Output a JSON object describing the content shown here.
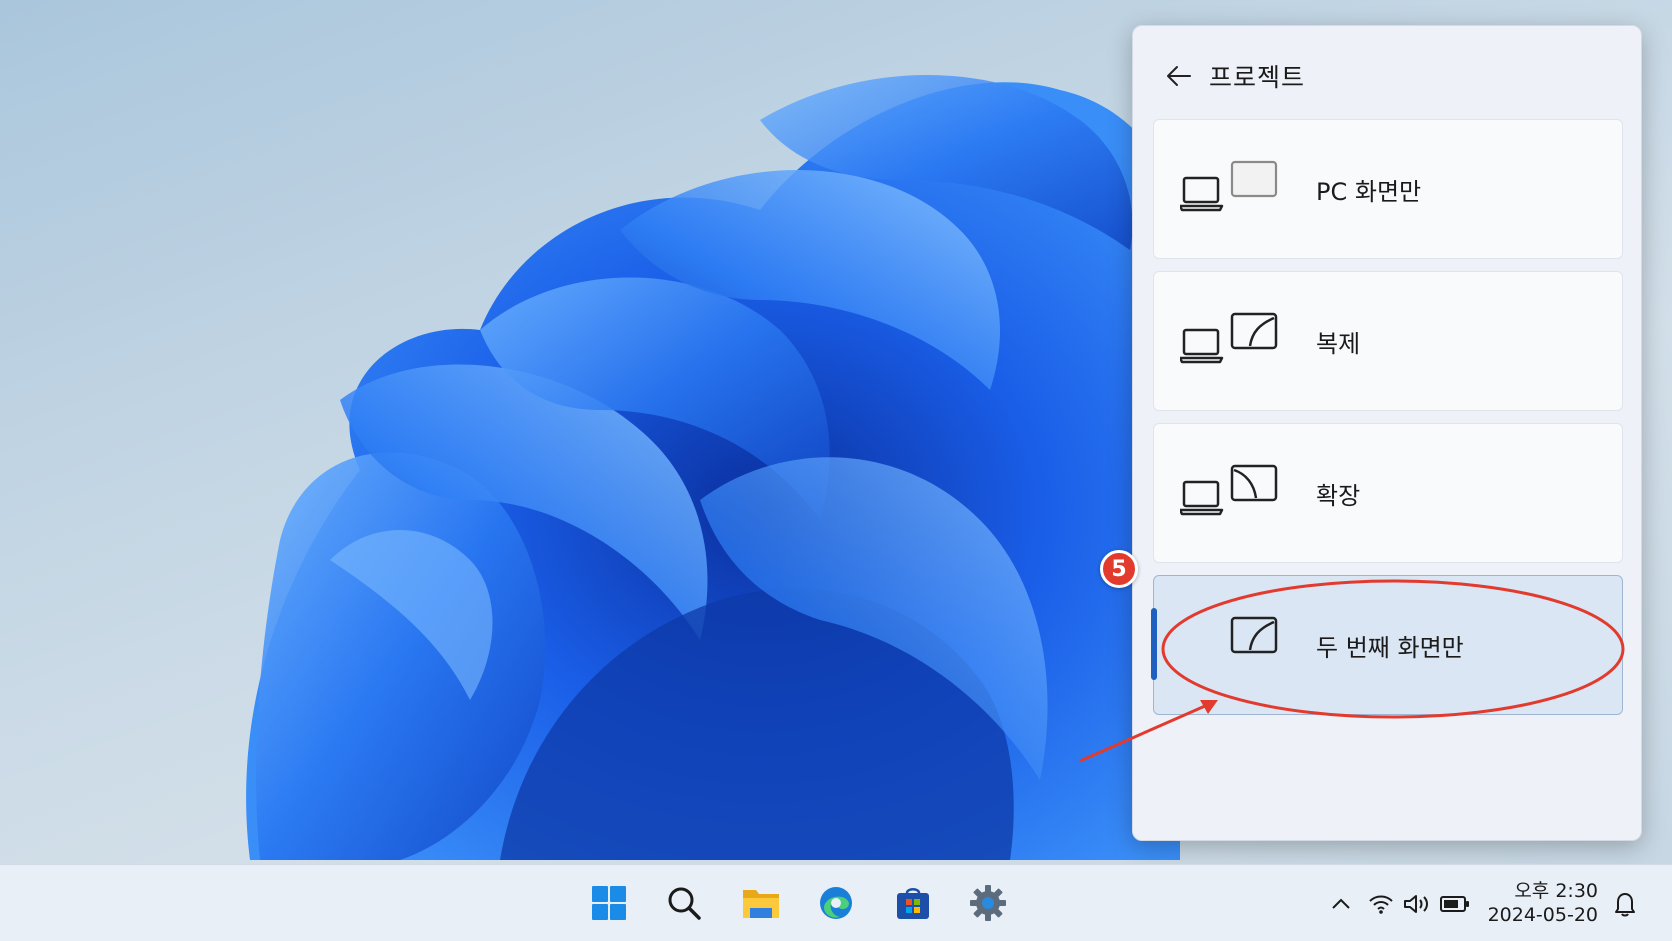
{
  "panel": {
    "title": "프로젝트",
    "options": [
      {
        "label": "PC 화면만",
        "icon": "pc-screen-only-icon",
        "selected": false
      },
      {
        "label": "복제",
        "icon": "duplicate-icon",
        "selected": false
      },
      {
        "label": "확장",
        "icon": "extend-icon",
        "selected": false
      },
      {
        "label": "두 번째 화면만",
        "icon": "second-screen-only-icon",
        "selected": true
      }
    ]
  },
  "annotation": {
    "step_number": "5",
    "color": "#e23b2e"
  },
  "taskbar": {
    "apps": [
      "start-icon",
      "search-icon",
      "file-explorer-icon",
      "edge-icon",
      "store-icon",
      "settings-icon"
    ],
    "tray": [
      "chevron-up-icon",
      "wifi-icon",
      "volume-icon",
      "battery-icon",
      "notification-bell-icon"
    ],
    "time": "오후 2:30",
    "date": "2024-05-20"
  },
  "colors": {
    "accent": "#1f5fbf",
    "panel_bg": "#eef2f8",
    "selected_bg": "#dae6f4"
  }
}
